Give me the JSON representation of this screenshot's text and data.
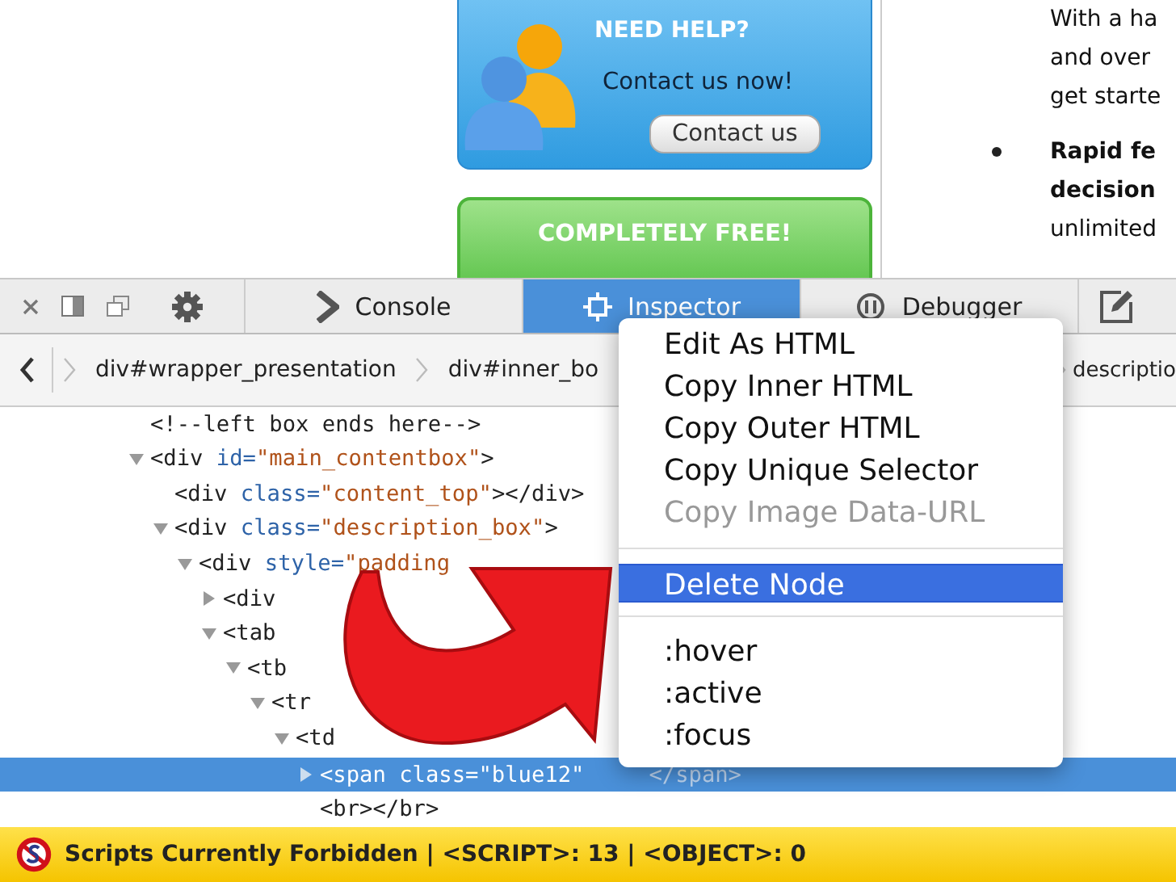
{
  "page": {
    "help_box": {
      "title": "NEED HELP?",
      "text": "Contact us now!",
      "button": "Contact us"
    },
    "free_banner": "COMPLETELY FREE!",
    "article": {
      "lines": [
        "With a ha",
        "and over",
        "get starte"
      ],
      "bullet": {
        "bold_lines": [
          "Rapid fe",
          "decision"
        ],
        "lines": [
          "unlimited"
        ]
      }
    }
  },
  "devtools": {
    "tabs": [
      {
        "label": "Console",
        "selected": false
      },
      {
        "label": "Inspector",
        "selected": true
      },
      {
        "label": "Debugger",
        "selected": false
      }
    ],
    "breadcrumbs": [
      "div#wrapper_presentation",
      "div#inner_bo",
      "descriptio"
    ],
    "tree": [
      {
        "kind": "leaf",
        "text": "<!--left box ends here-->",
        "selected": false
      },
      {
        "kind": "parent",
        "text": "<div id=\"main_contentbox\">",
        "expanded": true,
        "selected": false,
        "children": [
          {
            "kind": "leaf",
            "text": "<div class=\"content_top\"></div>",
            "selected": false
          },
          {
            "kind": "parent",
            "text": "<div class=\"description_box\">",
            "expanded": true,
            "selected": false,
            "children": [
              {
                "kind": "parent",
                "text": "<div style=\"padding",
                "expanded": true,
                "selected": false,
                "children": [
                  {
                    "kind": "parent",
                    "text": "<div",
                    "expanded": false,
                    "selected": false
                  },
                  {
                    "kind": "parent",
                    "text": "<tab",
                    "expanded": true,
                    "selected": false,
                    "children": [
                      {
                        "kind": "parent",
                        "text": "<tb",
                        "expanded": true,
                        "selected": false,
                        "children": [
                          {
                            "kind": "parent",
                            "text": "<tr",
                            "expanded": true,
                            "selected": false,
                            "children": [
                              {
                                "kind": "parent",
                                "text": "<td",
                                "expanded": true,
                                "selected": false,
                                "children": [
                                  {
                                    "kind": "parent",
                                    "text": "<span class=\"blue12\"",
                                    "closing": "</span>",
                                    "expanded": false,
                                    "selected": true
                                  },
                                  {
                                    "kind": "leaf",
                                    "text": "<br></br>",
                                    "selected": false
                                  }
                                ]
                              }
                            ]
                          }
                        ]
                      }
                    ]
                  }
                ]
              }
            ]
          }
        ]
      }
    ]
  },
  "context_menu": [
    {
      "kind": "item",
      "label": "Edit As HTML",
      "disabled": false,
      "selected": false
    },
    {
      "kind": "item",
      "label": "Copy Inner HTML",
      "disabled": false,
      "selected": false
    },
    {
      "kind": "item",
      "label": "Copy Outer HTML",
      "disabled": false,
      "selected": false
    },
    {
      "kind": "item",
      "label": "Copy Unique Selector",
      "disabled": false,
      "selected": false
    },
    {
      "kind": "item",
      "label": "Copy Image Data-URL",
      "disabled": true,
      "selected": false
    },
    {
      "kind": "separator"
    },
    {
      "kind": "item",
      "label": "Delete Node",
      "disabled": false,
      "selected": true
    },
    {
      "kind": "separator"
    },
    {
      "kind": "item",
      "label": ":hover",
      "disabled": false,
      "selected": false
    },
    {
      "kind": "item",
      "label": ":active",
      "disabled": false,
      "selected": false
    },
    {
      "kind": "item",
      "label": ":focus",
      "disabled": false,
      "selected": false
    }
  ],
  "status_bar": {
    "text": "Scripts Currently Forbidden | <SCRIPT>: 13 | <OBJECT>: 0"
  }
}
